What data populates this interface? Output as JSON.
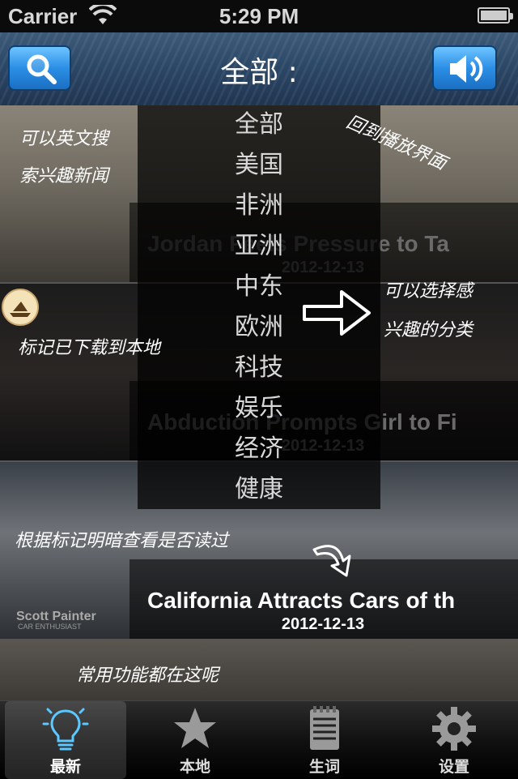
{
  "status_bar": {
    "carrier": "Carrier",
    "time": "5:29 PM"
  },
  "nav": {
    "title": "全部 :",
    "search_icon": "search-icon",
    "sound_icon": "speaker-icon"
  },
  "news": [
    {
      "title": "Jordan Feels Pressure to Ta",
      "date": "2012-12-13",
      "read": true
    },
    {
      "title": "Abduction Prompts Girl to Fi",
      "date": "2012-12-13",
      "read": true
    },
    {
      "title": "California Attracts Cars of th",
      "date": "2012-12-13",
      "read": false
    }
  ],
  "thumbnail_text": {
    "scott_painter": "Scott Painter",
    "car_enthusiast": "CAR ENTHUSIAST"
  },
  "categories": [
    "全部",
    "美国",
    "非洲",
    "亚洲",
    "中东",
    "欧洲",
    "科技",
    "娱乐",
    "经济",
    "健康"
  ],
  "annotations": {
    "search_hint_1": "可以英文搜",
    "search_hint_2": "索兴趣新闻",
    "back_to_player": "回到播放界面",
    "category_hint_1": "可以选择感",
    "category_hint_2": "兴趣的分类",
    "downloaded_hint": "标记已下载到本地",
    "read_hint": "根据标记明暗查看是否读过",
    "common_functions": "常用功能都在这呢"
  },
  "tabs": [
    {
      "label": "最新",
      "icon": "lightbulb-icon",
      "selected": true
    },
    {
      "label": "本地",
      "icon": "star-icon",
      "selected": false
    },
    {
      "label": "生词",
      "icon": "notepad-icon",
      "selected": false
    },
    {
      "label": "设置",
      "icon": "gear-icon",
      "selected": false
    }
  ],
  "colors": {
    "nav_button": "#2b8fe6",
    "tab_highlight": "#5bc8ff"
  }
}
